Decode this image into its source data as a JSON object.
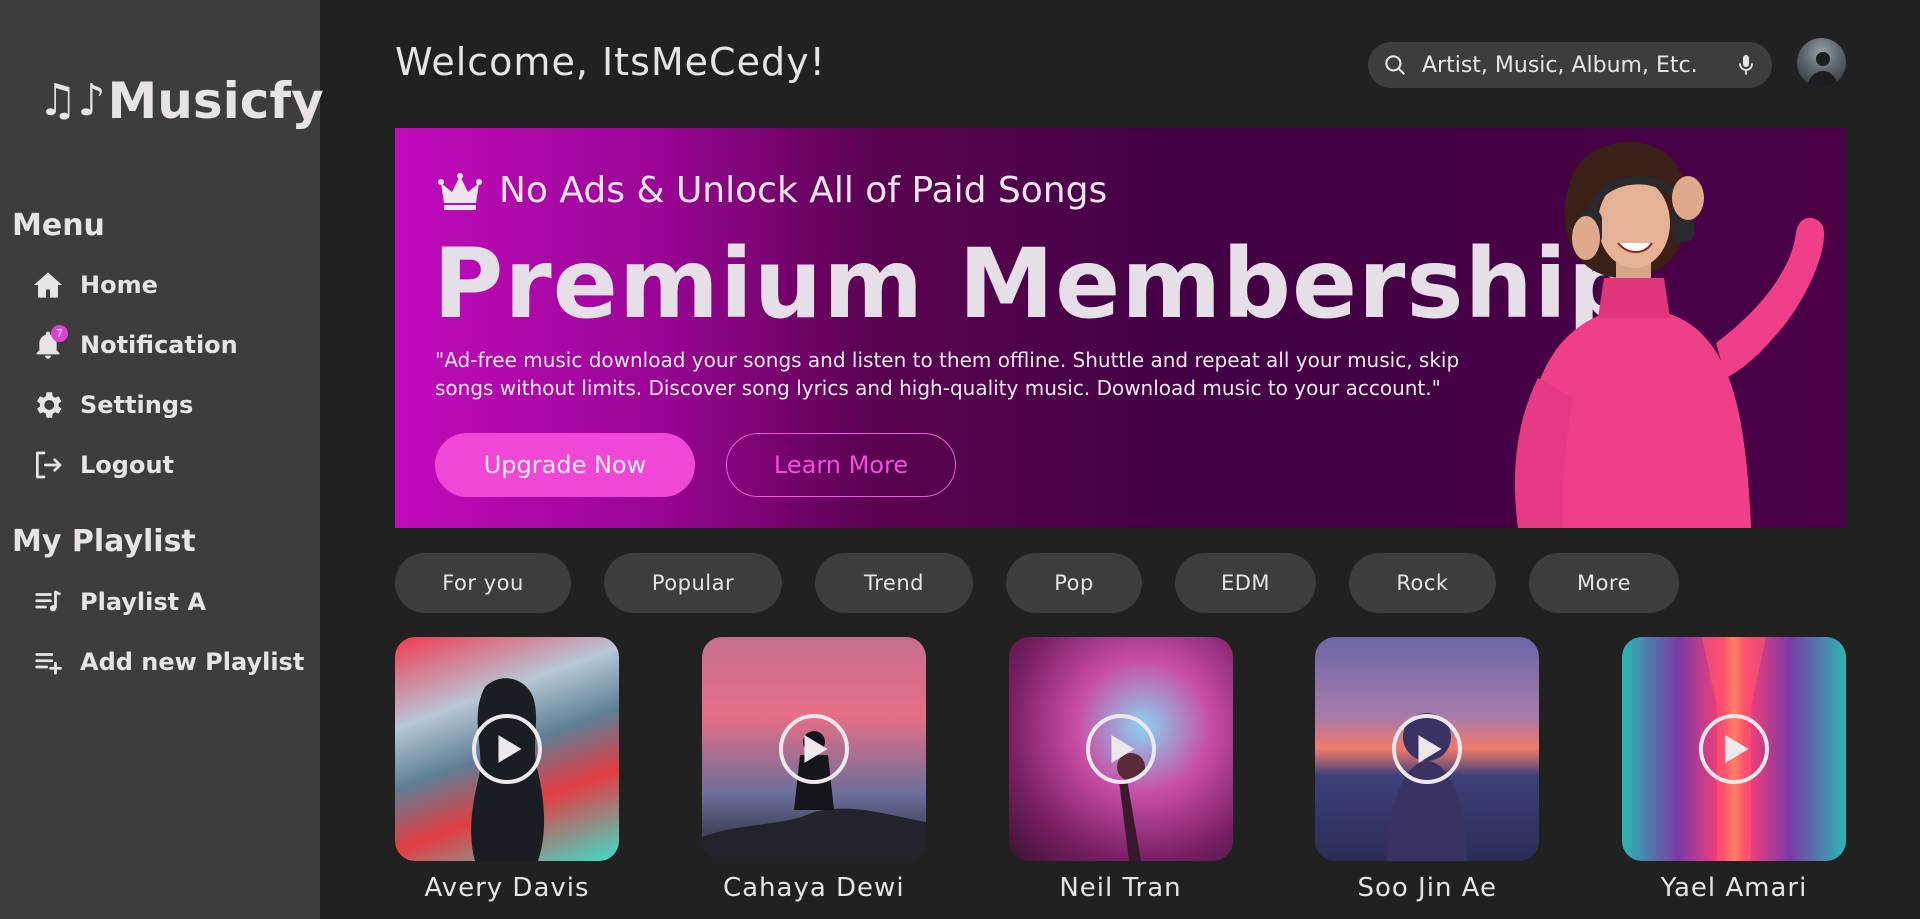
{
  "app": {
    "logo_notes": "♫♪",
    "logo_text": "Musicfy"
  },
  "sidebar": {
    "menu_title": "Menu",
    "menu_items": [
      {
        "label": "Home",
        "icon": "home-icon"
      },
      {
        "label": "Notification",
        "icon": "bell-icon",
        "badge": "7"
      },
      {
        "label": "Settings",
        "icon": "gear-icon"
      },
      {
        "label": "Logout",
        "icon": "logout-icon"
      }
    ],
    "playlist_title": "My Playlist",
    "playlist_items": [
      {
        "label": "Playlist A",
        "icon": "playlist-icon"
      },
      {
        "label": "Add new Playlist",
        "icon": "playlist-add-icon"
      }
    ]
  },
  "header": {
    "welcome": "Welcome, ItsMeCedy!",
    "search_placeholder": "Artist, Music, Album, Etc."
  },
  "banner": {
    "tagline": "No Ads & Unlock All of Paid Songs",
    "title": "Premium Membership",
    "description": "\"Ad-free music download your songs and listen to them offline. Shuttle and repeat all your music, skip songs without limits. Discover song lyrics and high-quality music. Download music to your account.\"",
    "primary_button": "Upgrade Now",
    "secondary_button": "Learn More"
  },
  "genres": [
    "For you",
    "Popular",
    "Trend",
    "Pop",
    "EDM",
    "Rock",
    "More"
  ],
  "artists": [
    {
      "name": "Avery Davis"
    },
    {
      "name": "Cahaya Dewi"
    },
    {
      "name": "Neil Tran"
    },
    {
      "name": "Soo Jin Ae"
    },
    {
      "name": "Yael Amari"
    }
  ],
  "colors": {
    "background": "#212121",
    "sidebar": "#3d3d3d",
    "accent": "#f048d6",
    "text": "#e8e3e6"
  }
}
